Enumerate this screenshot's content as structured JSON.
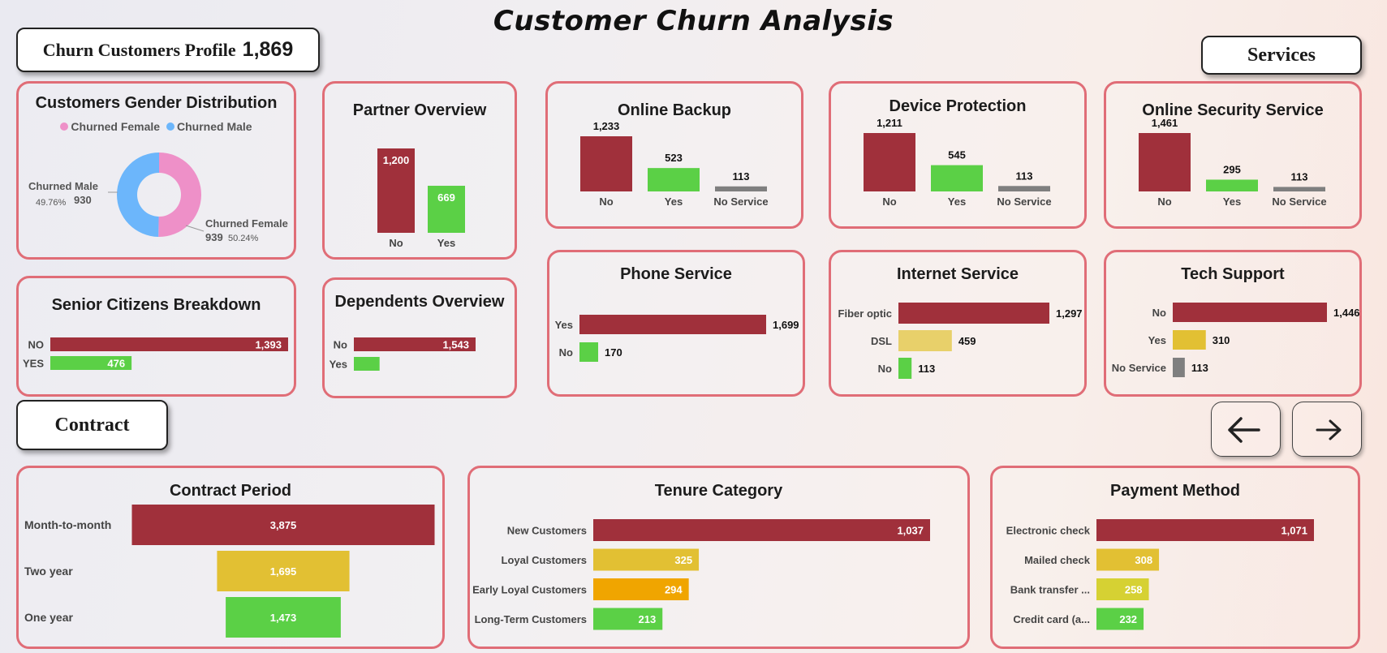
{
  "title": "Customer Churn Analysis",
  "profile": {
    "label": "Churn Customers Profile",
    "count": "1,869"
  },
  "sections": {
    "services": "Services",
    "contract": "Contract"
  },
  "colors": {
    "red": "#a0303b",
    "green": "#5bd046",
    "gray": "#7f7f7f",
    "pink": "#ee90c8",
    "blue": "#6cb6fb",
    "mustard": "#e2c033",
    "lightmustard": "#e8d06a",
    "orange": "#f0a500",
    "lime": "#d6d133"
  },
  "icons": {
    "prev": "arrow-left-icon",
    "next": "arrow-right-icon"
  },
  "charts": {
    "gender": {
      "title": "Customers Gender Distribution",
      "type": "pie",
      "legend": [
        "Churned Female",
        "Churned Male"
      ],
      "slices": [
        {
          "name": "Churned Female",
          "value": 939,
          "value_label": "939",
          "pct_label": "50.24%"
        },
        {
          "name": "Churned Male",
          "value": 930,
          "value_label": "930",
          "pct_label": "49.76%"
        }
      ]
    },
    "partner": {
      "title": "Partner Overview",
      "type": "bar",
      "bars": [
        {
          "category": "No",
          "value": 1200,
          "label": "1,200"
        },
        {
          "category": "Yes",
          "value": 669,
          "label": "669"
        }
      ]
    },
    "online_backup": {
      "title": "Online Backup",
      "type": "bar",
      "bars": [
        {
          "category": "No",
          "value": 1233,
          "label": "1,233"
        },
        {
          "category": "Yes",
          "value": 523,
          "label": "523"
        },
        {
          "category": "No Service",
          "value": 113,
          "label": "113"
        }
      ]
    },
    "device_protection": {
      "title": "Device Protection",
      "type": "bar",
      "bars": [
        {
          "category": "No",
          "value": 1211,
          "label": "1,211"
        },
        {
          "category": "Yes",
          "value": 545,
          "label": "545"
        },
        {
          "category": "No Service",
          "value": 113,
          "label": "113"
        }
      ]
    },
    "online_security": {
      "title": "Online Security Service",
      "type": "bar",
      "bars": [
        {
          "category": "No",
          "value": 1461,
          "label": "1,461"
        },
        {
          "category": "Yes",
          "value": 295,
          "label": "295"
        },
        {
          "category": "No Service",
          "value": 113,
          "label": "113"
        }
      ]
    },
    "senior": {
      "title": "Senior Citizens Breakdown",
      "type": "bar",
      "bars": [
        {
          "category": "NO",
          "value": 1393,
          "label": "1,393"
        },
        {
          "category": "YES",
          "value": 476,
          "label": "476"
        }
      ]
    },
    "dependents": {
      "title": "Dependents Overview",
      "type": "bar",
      "bars": [
        {
          "category": "No",
          "value": 1543,
          "label": "1,543"
        },
        {
          "category": "Yes",
          "value": 326,
          "label": ""
        }
      ]
    },
    "phone": {
      "title": "Phone Service",
      "type": "bar",
      "bars": [
        {
          "category": "Yes",
          "value": 1699,
          "label": "1,699"
        },
        {
          "category": "No",
          "value": 170,
          "label": "170"
        }
      ]
    },
    "internet": {
      "title": "Internet Service",
      "type": "bar",
      "bars": [
        {
          "category": "Fiber optic",
          "value": 1297,
          "label": "1,297"
        },
        {
          "category": "DSL",
          "value": 459,
          "label": "459"
        },
        {
          "category": "No",
          "value": 113,
          "label": "113"
        }
      ]
    },
    "tech": {
      "title": "Tech Support",
      "type": "bar",
      "bars": [
        {
          "category": "No",
          "value": 1446,
          "label": "1,446"
        },
        {
          "category": "Yes",
          "value": 310,
          "label": "310"
        },
        {
          "category": "No Service",
          "value": 113,
          "label": "113"
        }
      ]
    },
    "contract": {
      "title": "Contract Period",
      "type": "bar",
      "bars": [
        {
          "category": "Month-to-month",
          "value": 3875,
          "label": "3,875"
        },
        {
          "category": "Two year",
          "value": 1695,
          "label": "1,695"
        },
        {
          "category": "One year",
          "value": 1473,
          "label": "1,473"
        }
      ]
    },
    "tenure": {
      "title": "Tenure Category",
      "type": "bar",
      "bars": [
        {
          "category": "New Customers",
          "value": 1037,
          "label": "1,037"
        },
        {
          "category": "Loyal Customers",
          "value": 325,
          "label": "325"
        },
        {
          "category": "Early Loyal Customers",
          "value": 294,
          "label": "294"
        },
        {
          "category": "Long-Term Customers",
          "value": 213,
          "label": "213"
        }
      ]
    },
    "payment": {
      "title": "Payment Method",
      "type": "bar",
      "bars": [
        {
          "category": "Electronic check",
          "value": 1071,
          "label": "1,071"
        },
        {
          "category": "Mailed check",
          "value": 308,
          "label": "308"
        },
        {
          "category": "Bank transfer ...",
          "value": 258,
          "label": "258"
        },
        {
          "category": "Credit card (a...",
          "value": 232,
          "label": "232"
        }
      ]
    }
  }
}
